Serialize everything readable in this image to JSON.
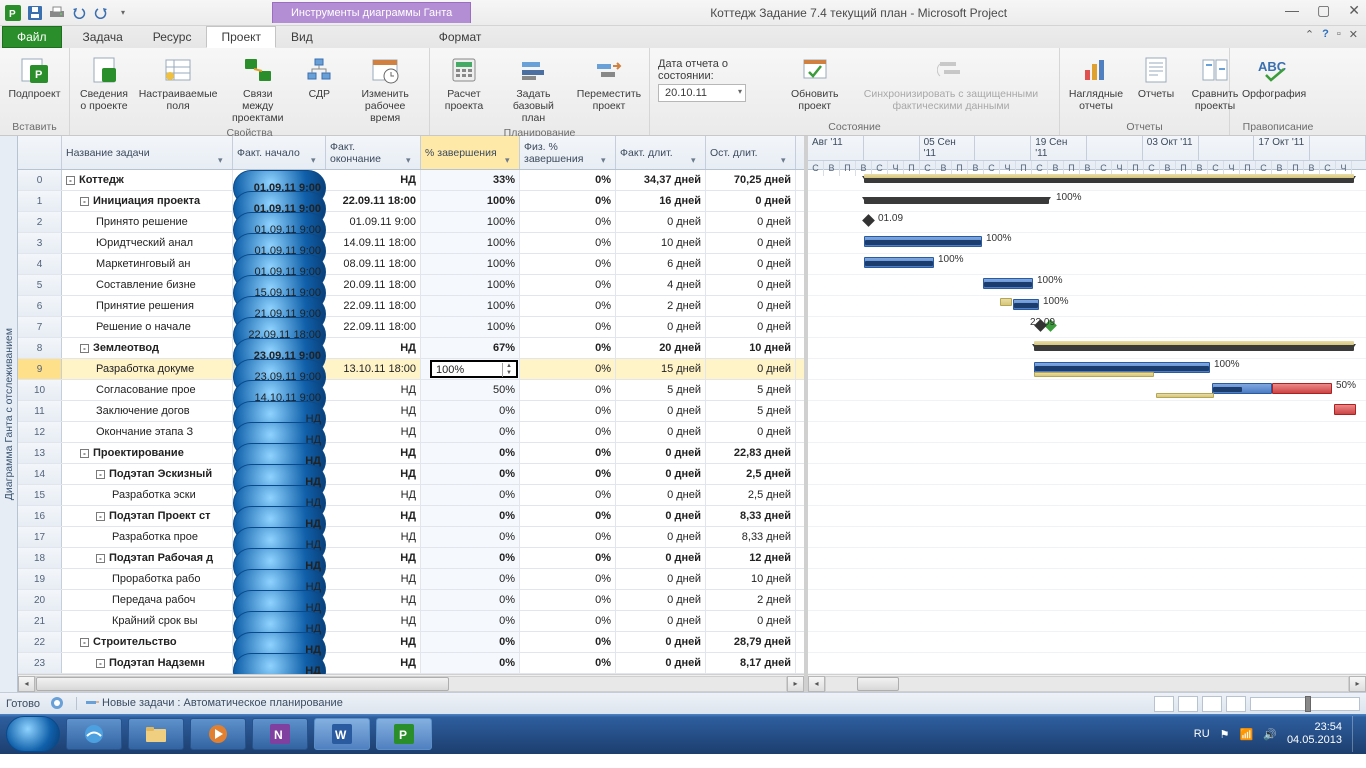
{
  "window": {
    "title": "Коттедж Задание 7.4 текущий план  -  Microsoft Project",
    "gantt_tools": "Инструменты диаграммы Ганта"
  },
  "tabs": {
    "file": "Файл",
    "task": "Задача",
    "resource": "Ресурс",
    "project": "Проект",
    "view": "Вид",
    "format": "Формат"
  },
  "ribbon": {
    "insert": {
      "subproject": "Подпроект",
      "label": "Вставить"
    },
    "properties": {
      "info": "Сведения\nо проекте",
      "customfields": "Настраиваемые\nполя",
      "links": "Связи между\nпроектами",
      "wbs": "СДР",
      "changetime": "Изменить\nрабочее время",
      "label": "Свойства"
    },
    "planning": {
      "calc": "Расчет\nпроекта",
      "baseline": "Задать\nбазовый план",
      "move": "Переместить\nпроект",
      "label": "Планирование"
    },
    "status": {
      "statusdate_lbl": "Дата отчета о состоянии:",
      "statusdate_val": "20.10.11",
      "update": "Обновить\nпроект",
      "sync": "Синхронизировать с защищенными\nфактическими данными",
      "label": "Состояние"
    },
    "reports": {
      "visual": "Наглядные\nотчеты",
      "reports": "Отчеты",
      "compare": "Сравнить\nпроекты",
      "label": "Отчеты"
    },
    "proof": {
      "spelling": "Орфография",
      "label": "Правописание"
    }
  },
  "side_label": "Диаграмма Ганта с отслеживанием",
  "columns": {
    "name": "Название задачи",
    "start": "Факт. начало",
    "finish": "Факт.\nокончание",
    "pct": "% завершения",
    "phys": "Физ. %\nзавершения",
    "adur": "Факт. длит.",
    "rdur": "Ост. длит."
  },
  "rows": [
    {
      "n": 0,
      "lvl": 0,
      "tog": "-",
      "name": "Коттедж",
      "b": 1,
      "start": "01.09.11 9:00",
      "finish": "НД",
      "pct": "33%",
      "phys": "0%",
      "adur": "34,37 дней",
      "rdur": "70,25 дней"
    },
    {
      "n": 1,
      "lvl": 1,
      "tog": "-",
      "name": "Инициация проекта",
      "b": 1,
      "start": "01.09.11 9:00",
      "finish": "22.09.11 18:00",
      "pct": "100%",
      "phys": "0%",
      "adur": "16 дней",
      "rdur": "0 дней"
    },
    {
      "n": 2,
      "lvl": 2,
      "name": "Принято решение",
      "start": "01.09.11 9:00",
      "finish": "01.09.11 9:00",
      "pct": "100%",
      "phys": "0%",
      "adur": "0 дней",
      "rdur": "0 дней"
    },
    {
      "n": 3,
      "lvl": 2,
      "name": "Юридтческий анал",
      "start": "01.09.11 9:00",
      "finish": "14.09.11 18:00",
      "pct": "100%",
      "phys": "0%",
      "adur": "10 дней",
      "rdur": "0 дней"
    },
    {
      "n": 4,
      "lvl": 2,
      "name": "Маркетинговый ан",
      "start": "01.09.11 9:00",
      "finish": "08.09.11 18:00",
      "pct": "100%",
      "phys": "0%",
      "adur": "6 дней",
      "rdur": "0 дней"
    },
    {
      "n": 5,
      "lvl": 2,
      "name": "Составление бизне",
      "start": "15.09.11 9:00",
      "finish": "20.09.11 18:00",
      "pct": "100%",
      "phys": "0%",
      "adur": "4 дней",
      "rdur": "0 дней"
    },
    {
      "n": 6,
      "lvl": 2,
      "name": "Принятие решения",
      "start": "21.09.11 9:00",
      "finish": "22.09.11 18:00",
      "pct": "100%",
      "phys": "0%",
      "adur": "2 дней",
      "rdur": "0 дней"
    },
    {
      "n": 7,
      "lvl": 2,
      "name": "Решение о начале",
      "start": "22.09.11 18:00",
      "finish": "22.09.11 18:00",
      "pct": "100%",
      "phys": "0%",
      "adur": "0 дней",
      "rdur": "0 дней"
    },
    {
      "n": 8,
      "lvl": 1,
      "tog": "-",
      "name": "Землеотвод",
      "b": 1,
      "start": "23.09.11 9:00",
      "finish": "НД",
      "pct": "67%",
      "phys": "0%",
      "adur": "20 дней",
      "rdur": "10 дней"
    },
    {
      "n": 9,
      "lvl": 2,
      "name": "Разработка докуме",
      "start": "23.09.11 9:00",
      "finish": "13.10.11 18:00",
      "pct": "100%",
      "phys": "0%",
      "adur": "15 дней",
      "rdur": "0 дней",
      "edit": true,
      "sel": true
    },
    {
      "n": 10,
      "lvl": 2,
      "name": "Согласование прое",
      "start": "14.10.11 9:00",
      "finish": "НД",
      "pct": "50%",
      "phys": "0%",
      "adur": "5 дней",
      "rdur": "5 дней"
    },
    {
      "n": 11,
      "lvl": 2,
      "name": "Заключение догов",
      "start": "НД",
      "finish": "НД",
      "pct": "0%",
      "phys": "0%",
      "adur": "0 дней",
      "rdur": "5 дней"
    },
    {
      "n": 12,
      "lvl": 2,
      "name": "Окончание этапа З",
      "start": "НД",
      "finish": "НД",
      "pct": "0%",
      "phys": "0%",
      "adur": "0 дней",
      "rdur": "0 дней"
    },
    {
      "n": 13,
      "lvl": 1,
      "tog": "-",
      "name": "Проектирование",
      "b": 1,
      "start": "НД",
      "finish": "НД",
      "pct": "0%",
      "phys": "0%",
      "adur": "0 дней",
      "rdur": "22,83 дней"
    },
    {
      "n": 14,
      "lvl": 2,
      "tog": "-",
      "name": "Подэтап Эскизный",
      "b": 1,
      "start": "НД",
      "finish": "НД",
      "pct": "0%",
      "phys": "0%",
      "adur": "0 дней",
      "rdur": "2,5 дней"
    },
    {
      "n": 15,
      "lvl": 3,
      "name": "Разработка эски",
      "start": "НД",
      "finish": "НД",
      "pct": "0%",
      "phys": "0%",
      "adur": "0 дней",
      "rdur": "2,5 дней"
    },
    {
      "n": 16,
      "lvl": 2,
      "tog": "-",
      "name": "Подэтап Проект ст",
      "b": 1,
      "start": "НД",
      "finish": "НД",
      "pct": "0%",
      "phys": "0%",
      "adur": "0 дней",
      "rdur": "8,33 дней"
    },
    {
      "n": 17,
      "lvl": 3,
      "name": "Разработка прое",
      "start": "НД",
      "finish": "НД",
      "pct": "0%",
      "phys": "0%",
      "adur": "0 дней",
      "rdur": "8,33 дней"
    },
    {
      "n": 18,
      "lvl": 2,
      "tog": "-",
      "name": "Подэтап Рабочая д",
      "b": 1,
      "start": "НД",
      "finish": "НД",
      "pct": "0%",
      "phys": "0%",
      "adur": "0 дней",
      "rdur": "12 дней"
    },
    {
      "n": 19,
      "lvl": 3,
      "name": "Проработка рабо",
      "start": "НД",
      "finish": "НД",
      "pct": "0%",
      "phys": "0%",
      "adur": "0 дней",
      "rdur": "10 дней"
    },
    {
      "n": 20,
      "lvl": 3,
      "name": "Передача рабоч",
      "start": "НД",
      "finish": "НД",
      "pct": "0%",
      "phys": "0%",
      "adur": "0 дней",
      "rdur": "2 дней"
    },
    {
      "n": 21,
      "lvl": 3,
      "name": "Крайний срок вы",
      "start": "НД",
      "finish": "НД",
      "pct": "0%",
      "phys": "0%",
      "adur": "0 дней",
      "rdur": "0 дней"
    },
    {
      "n": 22,
      "lvl": 1,
      "tog": "-",
      "name": "Строительство",
      "b": 1,
      "start": "НД",
      "finish": "НД",
      "pct": "0%",
      "phys": "0%",
      "adur": "0 дней",
      "rdur": "28,79 дней"
    },
    {
      "n": 23,
      "lvl": 2,
      "tog": "-",
      "name": "Подэтап Надземн",
      "b": 1,
      "start": "НД",
      "finish": "НД",
      "pct": "0%",
      "phys": "0%",
      "adur": "0 дней",
      "rdur": "8,17 дней"
    }
  ],
  "timeline": {
    "top": [
      "Авг '11",
      "",
      "05 Сен '11",
      "",
      "19 Сен '11",
      "",
      "03 Окт '11",
      "",
      "17 Окт '11",
      ""
    ],
    "bot": [
      "С",
      "В",
      "П",
      "В",
      "С",
      "Ч",
      "П",
      "С",
      "В",
      "П",
      "В",
      "С",
      "Ч",
      "П",
      "С",
      "В",
      "П",
      "В",
      "С",
      "Ч",
      "П",
      "С",
      "В",
      "П",
      "В",
      "С",
      "Ч",
      "П",
      "С",
      "В",
      "П",
      "В",
      "С",
      "Ч"
    ]
  },
  "gantt_labels": {
    "p100": "100%",
    "p50": "50%",
    "d0109": "01.09",
    "d2209": "22.09"
  },
  "statusbar": {
    "ready": "Готово",
    "newtasks": "Новые задачи : Автоматическое планирование"
  },
  "tray": {
    "lang": "RU",
    "time": "23:54",
    "date": "04.05.2013"
  }
}
